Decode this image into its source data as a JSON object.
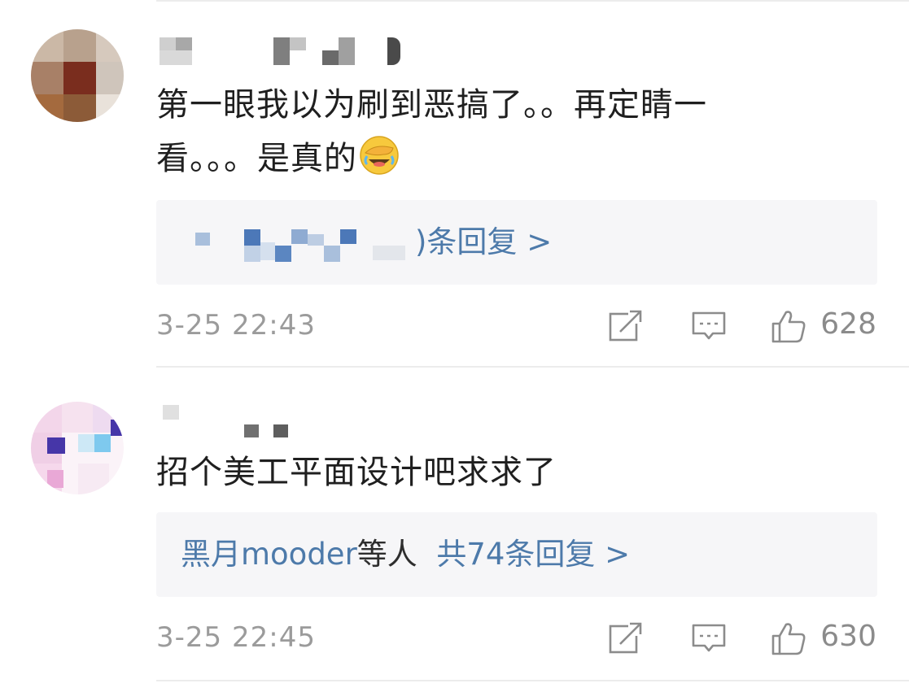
{
  "comments": [
    {
      "text_line1": "第一眼我以为刷到恶搞了。。再定睛一",
      "text_line2": "看。。。是真的",
      "emoji": "facepalm-laughing-emoji",
      "reply_suffix": ")条回复 >",
      "time": "3-25 22:43",
      "likes": "628"
    },
    {
      "text_line1": "招个美工平面设计吧求求了",
      "reply_author": "黑月mooder",
      "reply_mid": "等人",
      "reply_count_text": "共74条回复 >",
      "time": "3-25 22:45",
      "likes": "630"
    }
  ],
  "icons": {
    "repost": "share-edit-icon",
    "comment": "comment-icon",
    "like": "thumbs-up-icon"
  },
  "colors": {
    "link": "#4d7aaa",
    "meta": "#9b9b9b",
    "reply_bg": "#f6f6f8"
  }
}
